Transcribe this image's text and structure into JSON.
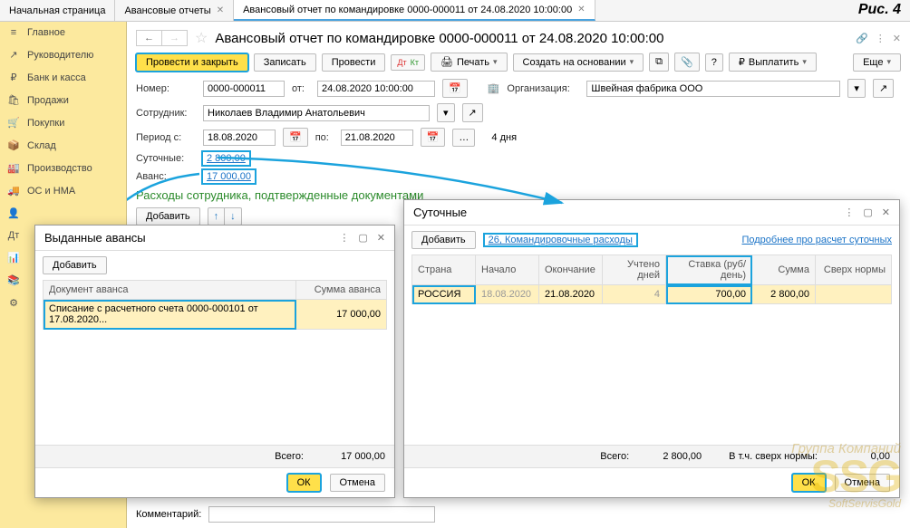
{
  "figLabel": "Рис. 4",
  "tabs": [
    {
      "label": "Начальная страница",
      "closable": false,
      "active": false
    },
    {
      "label": "Авансовые отчеты",
      "closable": true,
      "active": false
    },
    {
      "label": "Авансовый отчет по командировке 0000-000011 от 24.08.2020 10:00:00",
      "closable": true,
      "active": true
    }
  ],
  "sidebar": [
    {
      "icon": "≡",
      "label": "Главное"
    },
    {
      "icon": "↗",
      "label": "Руководителю"
    },
    {
      "icon": "₽",
      "label": "Банк и касса"
    },
    {
      "icon": "🛍",
      "label": "Продажи"
    },
    {
      "icon": "🛒",
      "label": "Покупки"
    },
    {
      "icon": "📦",
      "label": "Склад"
    },
    {
      "icon": "🏭",
      "label": "Производство"
    },
    {
      "icon": "🚚",
      "label": "ОС и НМА"
    },
    {
      "icon": "👤",
      "label": ""
    },
    {
      "icon": "Дт",
      "label": ""
    },
    {
      "icon": "📊",
      "label": ""
    },
    {
      "icon": "📚",
      "label": ""
    },
    {
      "icon": "⚙",
      "label": ""
    }
  ],
  "doc": {
    "title": "Авансовый отчет по командировке 0000-000011 от 24.08.2020 10:00:00",
    "toolbar": {
      "postClose": "Провести и закрыть",
      "save": "Записать",
      "post": "Провести",
      "print": "Печать",
      "createBased": "Создать на основании",
      "pay": "Выплатить",
      "more": "Еще"
    },
    "numberLbl": "Номер:",
    "number": "0000-000011",
    "fromLbl": "от:",
    "date": "24.08.2020 10:00:00",
    "orgLbl": "Организация:",
    "org": "Швейная фабрика ООО",
    "empLbl": "Сотрудник:",
    "emp": "Николаев Владимир Анатольевич",
    "periodFromLbl": "Период с:",
    "periodFrom": "18.08.2020",
    "periodToLbl": "по:",
    "periodTo": "21.08.2020",
    "daysText": "4 дня",
    "perDiemLbl": "Суточные:",
    "perDiem": "2 800,00",
    "advanceLbl": "Аванс:",
    "advance": "17 000,00",
    "expensesTitle": "Расходы сотрудника, подтвержденные документами",
    "add": "Добавить",
    "commentLbl": "Комментарий:"
  },
  "advPopup": {
    "title": "Выданные авансы",
    "add": "Добавить",
    "cols": [
      "Документ аванса",
      "Сумма аванса"
    ],
    "rows": [
      {
        "doc": "Списание с расчетного счета 0000-000101 от 17.08.2020...",
        "sum": "17 000,00"
      }
    ],
    "totalLbl": "Всего:",
    "total": "17 000,00",
    "ok": "ОК",
    "cancel": "Отмена"
  },
  "perDiemPopup": {
    "title": "Суточные",
    "add": "Добавить",
    "link26": "26, Командировочные расходы",
    "moreLink": "Подробнее про расчет суточных",
    "cols": [
      "Страна",
      "Начало",
      "Окончание",
      "Учтено дней",
      "Ставка (руб/день)",
      "Сумма",
      "Сверх нормы"
    ],
    "rows": [
      {
        "country": "РОССИЯ",
        "start": "18.08.2020",
        "end": "21.08.2020",
        "days": "4",
        "rate": "700,00",
        "sum": "2 800,00",
        "over": ""
      }
    ],
    "totalLbl": "Всего:",
    "total": "2 800,00",
    "overLbl": "В т.ч. сверх нормы:",
    "over": "0,00",
    "ok": "ОК",
    "cancel": "Отмена"
  },
  "watermark": {
    "l1": "Группа Компаний",
    "l2": "SSG",
    "l3": "SoftServisGold"
  }
}
